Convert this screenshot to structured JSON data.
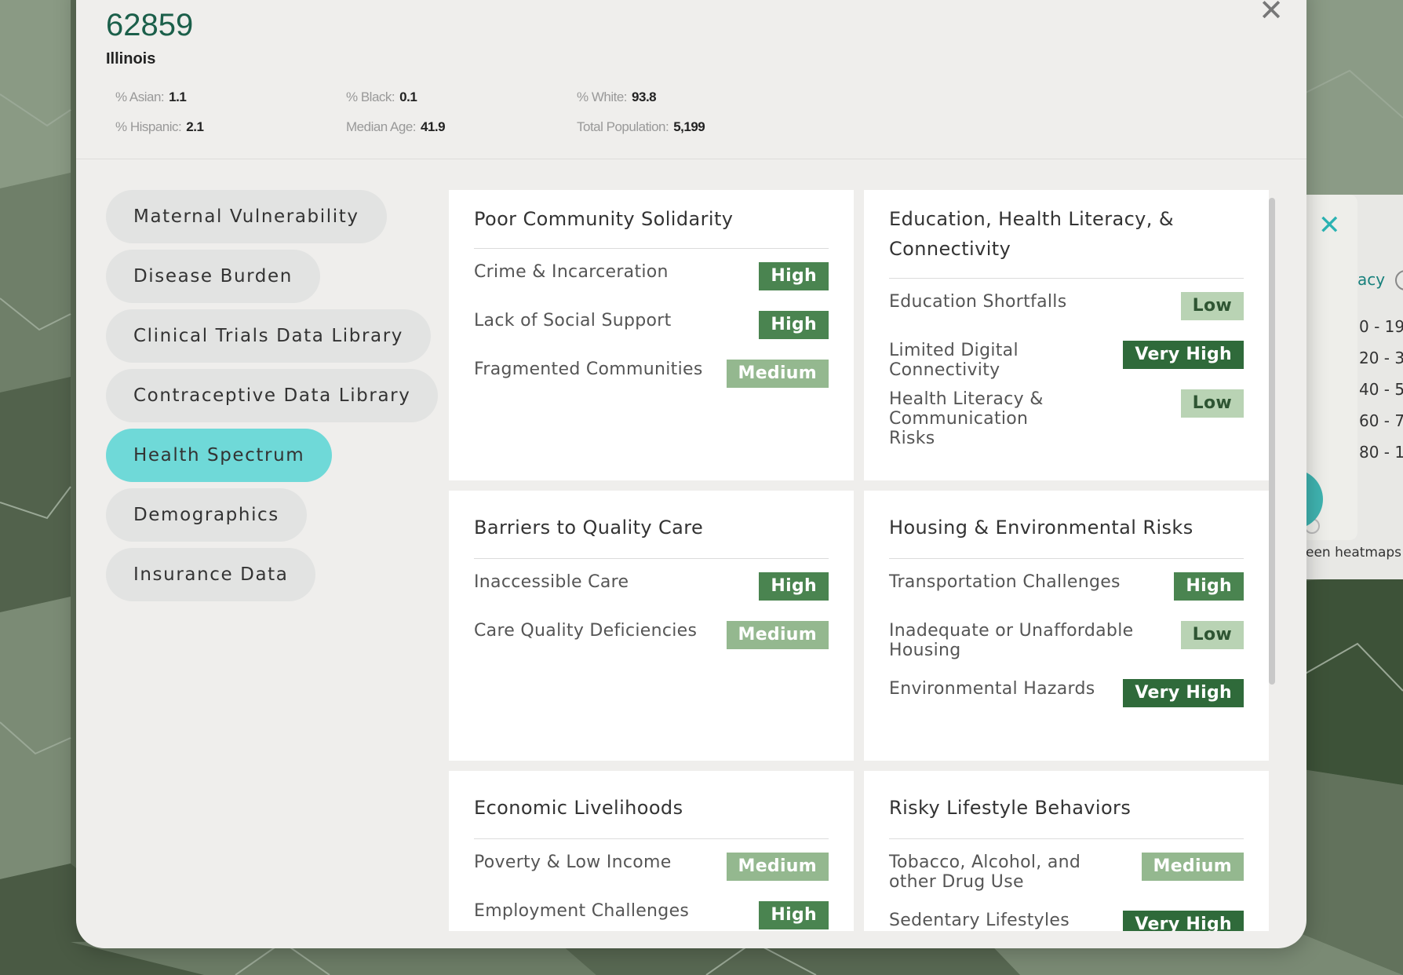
{
  "header": {
    "zip": "62859",
    "state": "Illinois",
    "stats": [
      {
        "label": "% Asian:",
        "value": "1.1"
      },
      {
        "label": "% Black:",
        "value": "0.1"
      },
      {
        "label": "% White:",
        "value": "93.8"
      },
      {
        "label": "% Hispanic:",
        "value": "2.1"
      },
      {
        "label": "Median Age:",
        "value": "41.9"
      },
      {
        "label": "Total Population:",
        "value": "5,199"
      }
    ]
  },
  "nav": {
    "items": [
      {
        "label": "Maternal Vulnerability"
      },
      {
        "label": "Disease Burden"
      },
      {
        "label": "Clinical Trials Data Library"
      },
      {
        "label": "Contraceptive Data Library"
      },
      {
        "label": "Health Spectrum",
        "active": true
      },
      {
        "label": "Demographics"
      },
      {
        "label": "Insurance Data"
      }
    ]
  },
  "cards": [
    {
      "title": "Poor Community Solidarity",
      "rows": [
        {
          "label": "Crime & Incarceration",
          "level": "High"
        },
        {
          "label": "Lack of Social Support",
          "level": "High"
        },
        {
          "label": "Fragmented Communities",
          "level": "Medium"
        }
      ]
    },
    {
      "title": "Education, Health Literacy, & Connectivity",
      "rows": [
        {
          "label": "Education Shortfalls",
          "level": "Low"
        },
        {
          "label": "Limited Digital Connectivity",
          "level": "Very High"
        },
        {
          "label": "Health Literacy & Communication Risks",
          "level": "Low"
        }
      ]
    },
    {
      "title": "Barriers to Quality Care",
      "rows": [
        {
          "label": "Inaccessible Care",
          "level": "High"
        },
        {
          "label": "Care Quality Deficiencies",
          "level": "Medium"
        }
      ]
    },
    {
      "title": "Housing & Environmental Risks",
      "rows": [
        {
          "label": "Transportation Challenges",
          "level": "High"
        },
        {
          "label": "Inadequate or Unaffordable Housing",
          "level": "Low"
        },
        {
          "label": "Environmental Hazards",
          "level": "Very High"
        }
      ]
    },
    {
      "title": "Economic Livelihoods",
      "rows": [
        {
          "label": "Poverty & Low Income",
          "level": "Medium"
        },
        {
          "label": "Employment Challenges",
          "level": "High"
        }
      ]
    },
    {
      "title": "Risky Lifestyle Behaviors",
      "rows": [
        {
          "label": "Tobacco, Alcohol, and other Drug Use",
          "level": "Medium"
        },
        {
          "label": "Sedentary Lifestyles",
          "level": "Very High"
        }
      ]
    }
  ],
  "legend": {
    "title": "acy",
    "ranges": [
      "0 - 19",
      "20 - 3",
      "40 - 5",
      "60 - 7",
      "80 - 1"
    ],
    "note": "een heatmaps"
  },
  "colors": {
    "accent": "#6fd9d8",
    "very_high": "#2f6a3a",
    "high": "#4a8450",
    "medium": "#94b88f",
    "low": "#b9d3b4"
  }
}
